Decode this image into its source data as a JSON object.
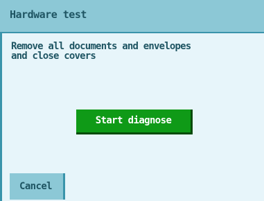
{
  "header": {
    "title": "Hardware test"
  },
  "message": {
    "line1": "Remove all documents and envelopes",
    "line2": "and close covers"
  },
  "actions": {
    "start_label": "Start diagnose",
    "cancel_label": "Cancel"
  },
  "colors": {
    "title_bar": "#8cc8d6",
    "content_bg": "#e7f5fa",
    "accent_border": "#3a94ab",
    "text": "#1f5563",
    "primary_button": "#0f9a17",
    "primary_button_shadow": "#064b0a"
  }
}
